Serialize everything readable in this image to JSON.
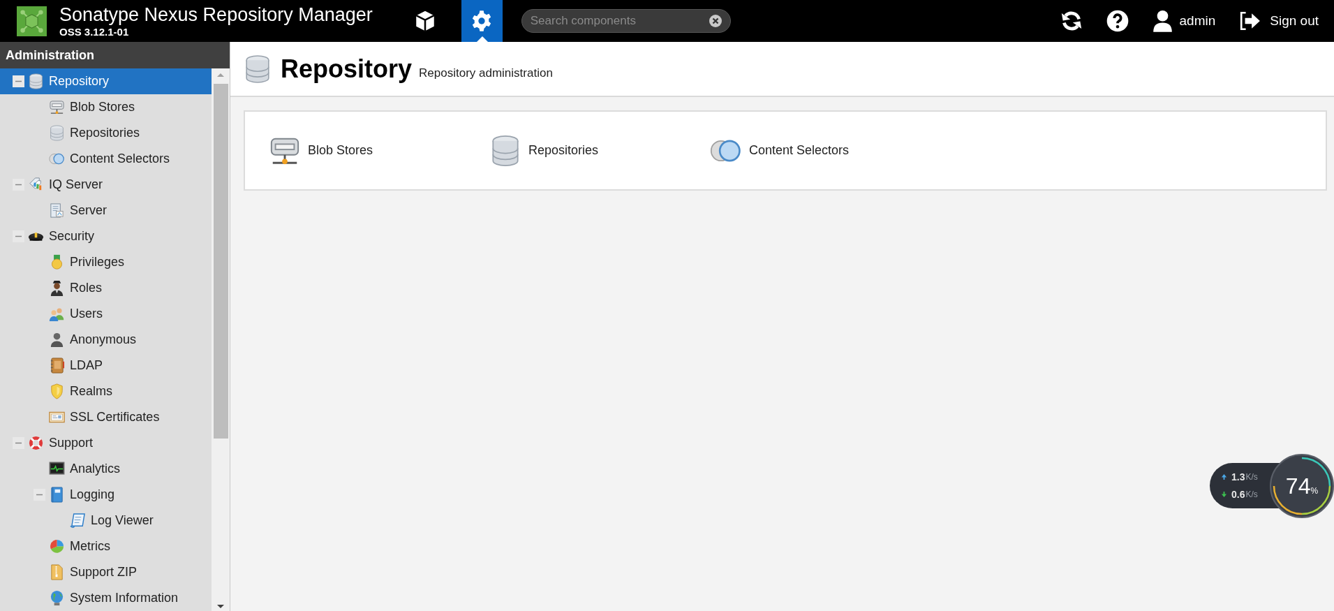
{
  "header": {
    "title": "Sonatype Nexus Repository Manager",
    "version": "OSS 3.12.1-01",
    "mode_buttons": [
      {
        "selected": false
      },
      {
        "selected": true
      }
    ],
    "search": {
      "placeholder": "Search components"
    },
    "user": "admin",
    "sign_out": "Sign out"
  },
  "sidebar": {
    "title": "Administration",
    "tree": [
      {
        "label": "Repository",
        "selected": true,
        "expanded": true,
        "children": [
          {
            "label": "Blob Stores",
            "selected": false
          },
          {
            "label": "Repositories",
            "selected": false
          },
          {
            "label": "Content Selectors",
            "selected": false
          }
        ]
      },
      {
        "label": "IQ Server",
        "selected": false,
        "expanded": true,
        "children": [
          {
            "label": "Server",
            "selected": false
          }
        ]
      },
      {
        "label": "Security",
        "selected": false,
        "expanded": true,
        "children": [
          {
            "label": "Privileges",
            "selected": false
          },
          {
            "label": "Roles",
            "selected": false
          },
          {
            "label": "Users",
            "selected": false
          },
          {
            "label": "Anonymous",
            "selected": false
          },
          {
            "label": "LDAP",
            "selected": false
          },
          {
            "label": "Realms",
            "selected": false
          },
          {
            "label": "SSL Certificates",
            "selected": false
          }
        ]
      },
      {
        "label": "Support",
        "selected": false,
        "expanded": true,
        "children": [
          {
            "label": "Analytics",
            "selected": false
          },
          {
            "label": "Logging",
            "selected": false,
            "expanded": true,
            "children": [
              {
                "label": "Log Viewer",
                "selected": false
              }
            ]
          },
          {
            "label": "Metrics",
            "selected": false
          },
          {
            "label": "Support ZIP",
            "selected": false
          },
          {
            "label": "System Information",
            "selected": false
          }
        ]
      }
    ]
  },
  "page": {
    "title": "Repository",
    "subtitle": "Repository administration",
    "items": [
      {
        "label": "Blob Stores"
      },
      {
        "label": "Repositories"
      },
      {
        "label": "Content Selectors"
      }
    ]
  },
  "net_monitor": {
    "upload": "1.3",
    "upload_unit": "K/s",
    "download": "0.6",
    "download_unit": "K/s",
    "usage": "74",
    "usage_unit": "%"
  }
}
